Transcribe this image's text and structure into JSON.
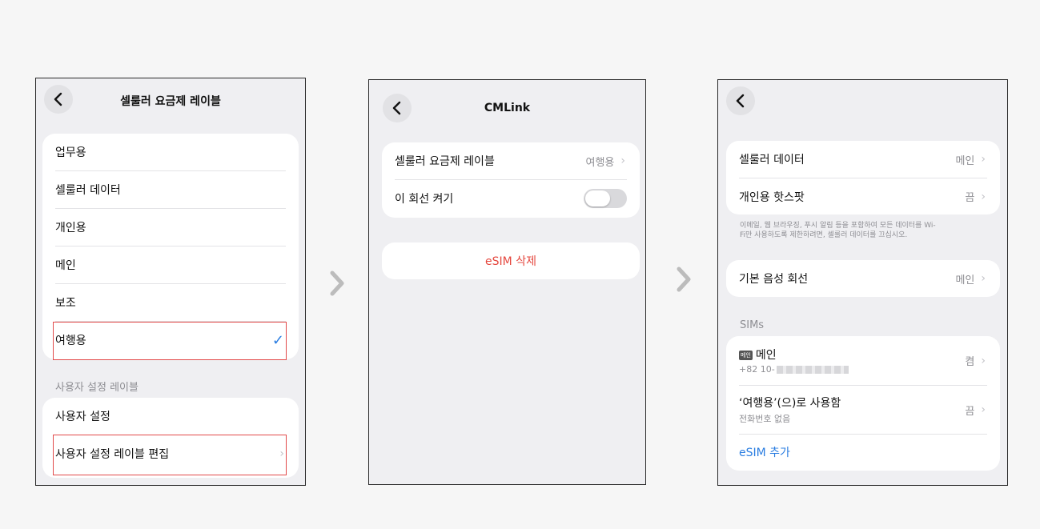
{
  "panel1": {
    "title": "셀룰러 요금제 레이블",
    "labels": [
      "업무용",
      "셀룰러 데이터",
      "개인용",
      "메인",
      "보조",
      "여행용"
    ],
    "check": "✓",
    "section_header": "사용자 설정 레이블",
    "custom_items": [
      "사용자 설정",
      "사용자 설정 레이블 편집"
    ]
  },
  "panel2": {
    "title": "CMLink",
    "plan_label": "셀룰러 요금제 레이블",
    "plan_value": "여행용",
    "line_toggle_label": "이 회선 켜기",
    "line_toggle_on": false,
    "delete_esim": "eSIM 삭제"
  },
  "panel3": {
    "cellular_data_label": "셀룰러 데이터",
    "cellular_data_value": "메인",
    "hotspot_label": "개인용 핫스팟",
    "hotspot_value": "끔",
    "footer_note_line1": "이메일, 웹 브라우징, 푸시 알림 등을 포함하여 모든 데이터를 Wi-",
    "footer_note_line2": "Fi만 사용하도록 제한하려면, 셀룰러 데이터를 끄십시오.",
    "default_voice_label": "기본 음성 회선",
    "default_voice_value": "메인",
    "sims_header": "SIMs",
    "sim1_badge": "메인",
    "sim1_name": "메인",
    "sim1_number": "+82 10-",
    "sim1_value": "켬",
    "sim2_name": "‘여행용’(으)로 사용함",
    "sim2_sub": "전화번호 없음",
    "sim2_value": "끔",
    "add_esim": "eSIM 추가"
  },
  "icons": {
    "back": "chevron-left-icon",
    "next": "chevron-right-icon",
    "check": "checkmark-icon"
  },
  "colors": {
    "highlight": "#e24a4a",
    "accent": "#2a7de1",
    "destructive": "#e5483f"
  }
}
